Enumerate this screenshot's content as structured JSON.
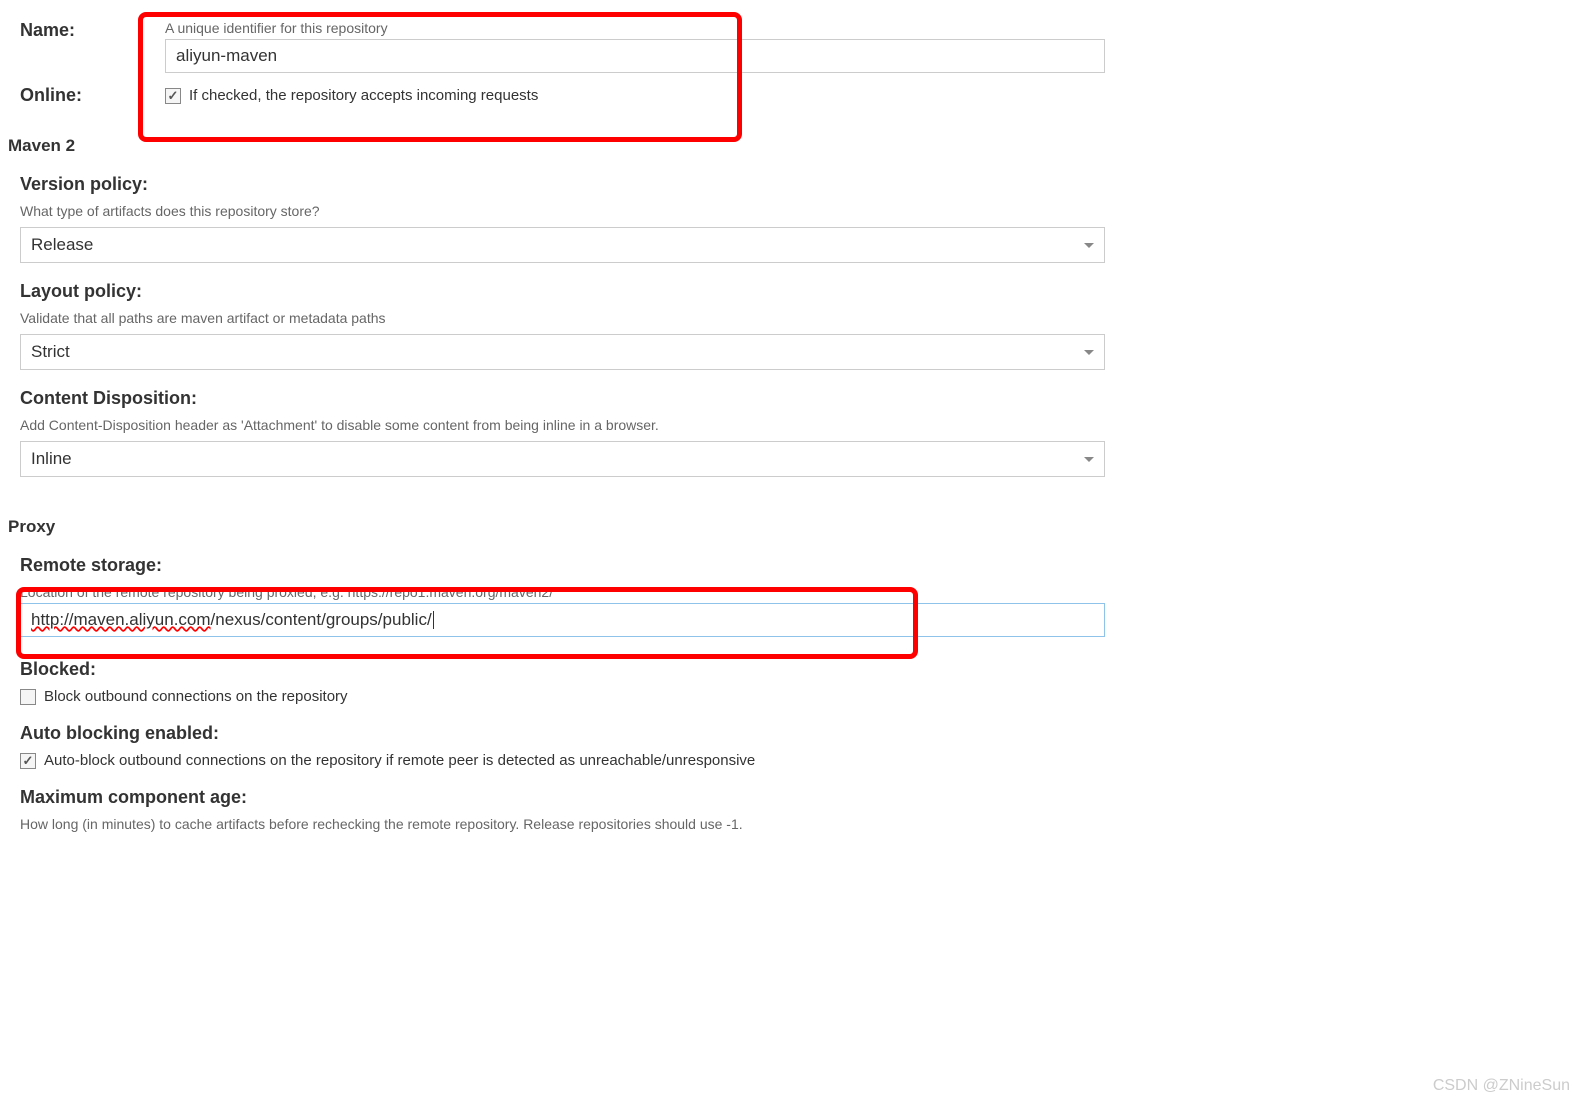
{
  "name": {
    "label": "Name:",
    "help": "A unique identifier for this repository",
    "value": "aliyun-maven"
  },
  "online": {
    "label": "Online:",
    "checked": true,
    "text": "If checked, the repository accepts incoming requests"
  },
  "maven2": {
    "header": "Maven 2",
    "version_policy": {
      "label": "Version policy:",
      "help": "What type of artifacts does this repository store?",
      "value": "Release"
    },
    "layout_policy": {
      "label": "Layout policy:",
      "help": "Validate that all paths are maven artifact or metadata paths",
      "value": "Strict"
    },
    "content_disposition": {
      "label": "Content Disposition:",
      "help": "Add Content-Disposition header as 'Attachment' to disable some content from being inline in a browser.",
      "value": "Inline"
    }
  },
  "proxy": {
    "header": "Proxy",
    "remote_storage": {
      "label": "Remote storage:",
      "help": "Location of the remote repository being proxied, e.g. https://repo1.maven.org/maven2/",
      "value_part1": "http://maven.aliyun.com",
      "value_part2": "/nexus/content/groups/public/",
      "value": "http://maven.aliyun.com/nexus/content/groups/public/"
    },
    "blocked": {
      "label": "Blocked:",
      "checked": false,
      "text": "Block outbound connections on the repository"
    },
    "auto_blocking": {
      "label": "Auto blocking enabled:",
      "checked": true,
      "text": "Auto-block outbound connections on the repository if remote peer is detected as unreachable/unresponsive"
    },
    "max_component_age": {
      "label": "Maximum component age:",
      "help": "How long (in minutes) to cache artifacts before rechecking the remote repository. Release repositories should use -1."
    }
  },
  "watermark": "CSDN @ZNineSun"
}
